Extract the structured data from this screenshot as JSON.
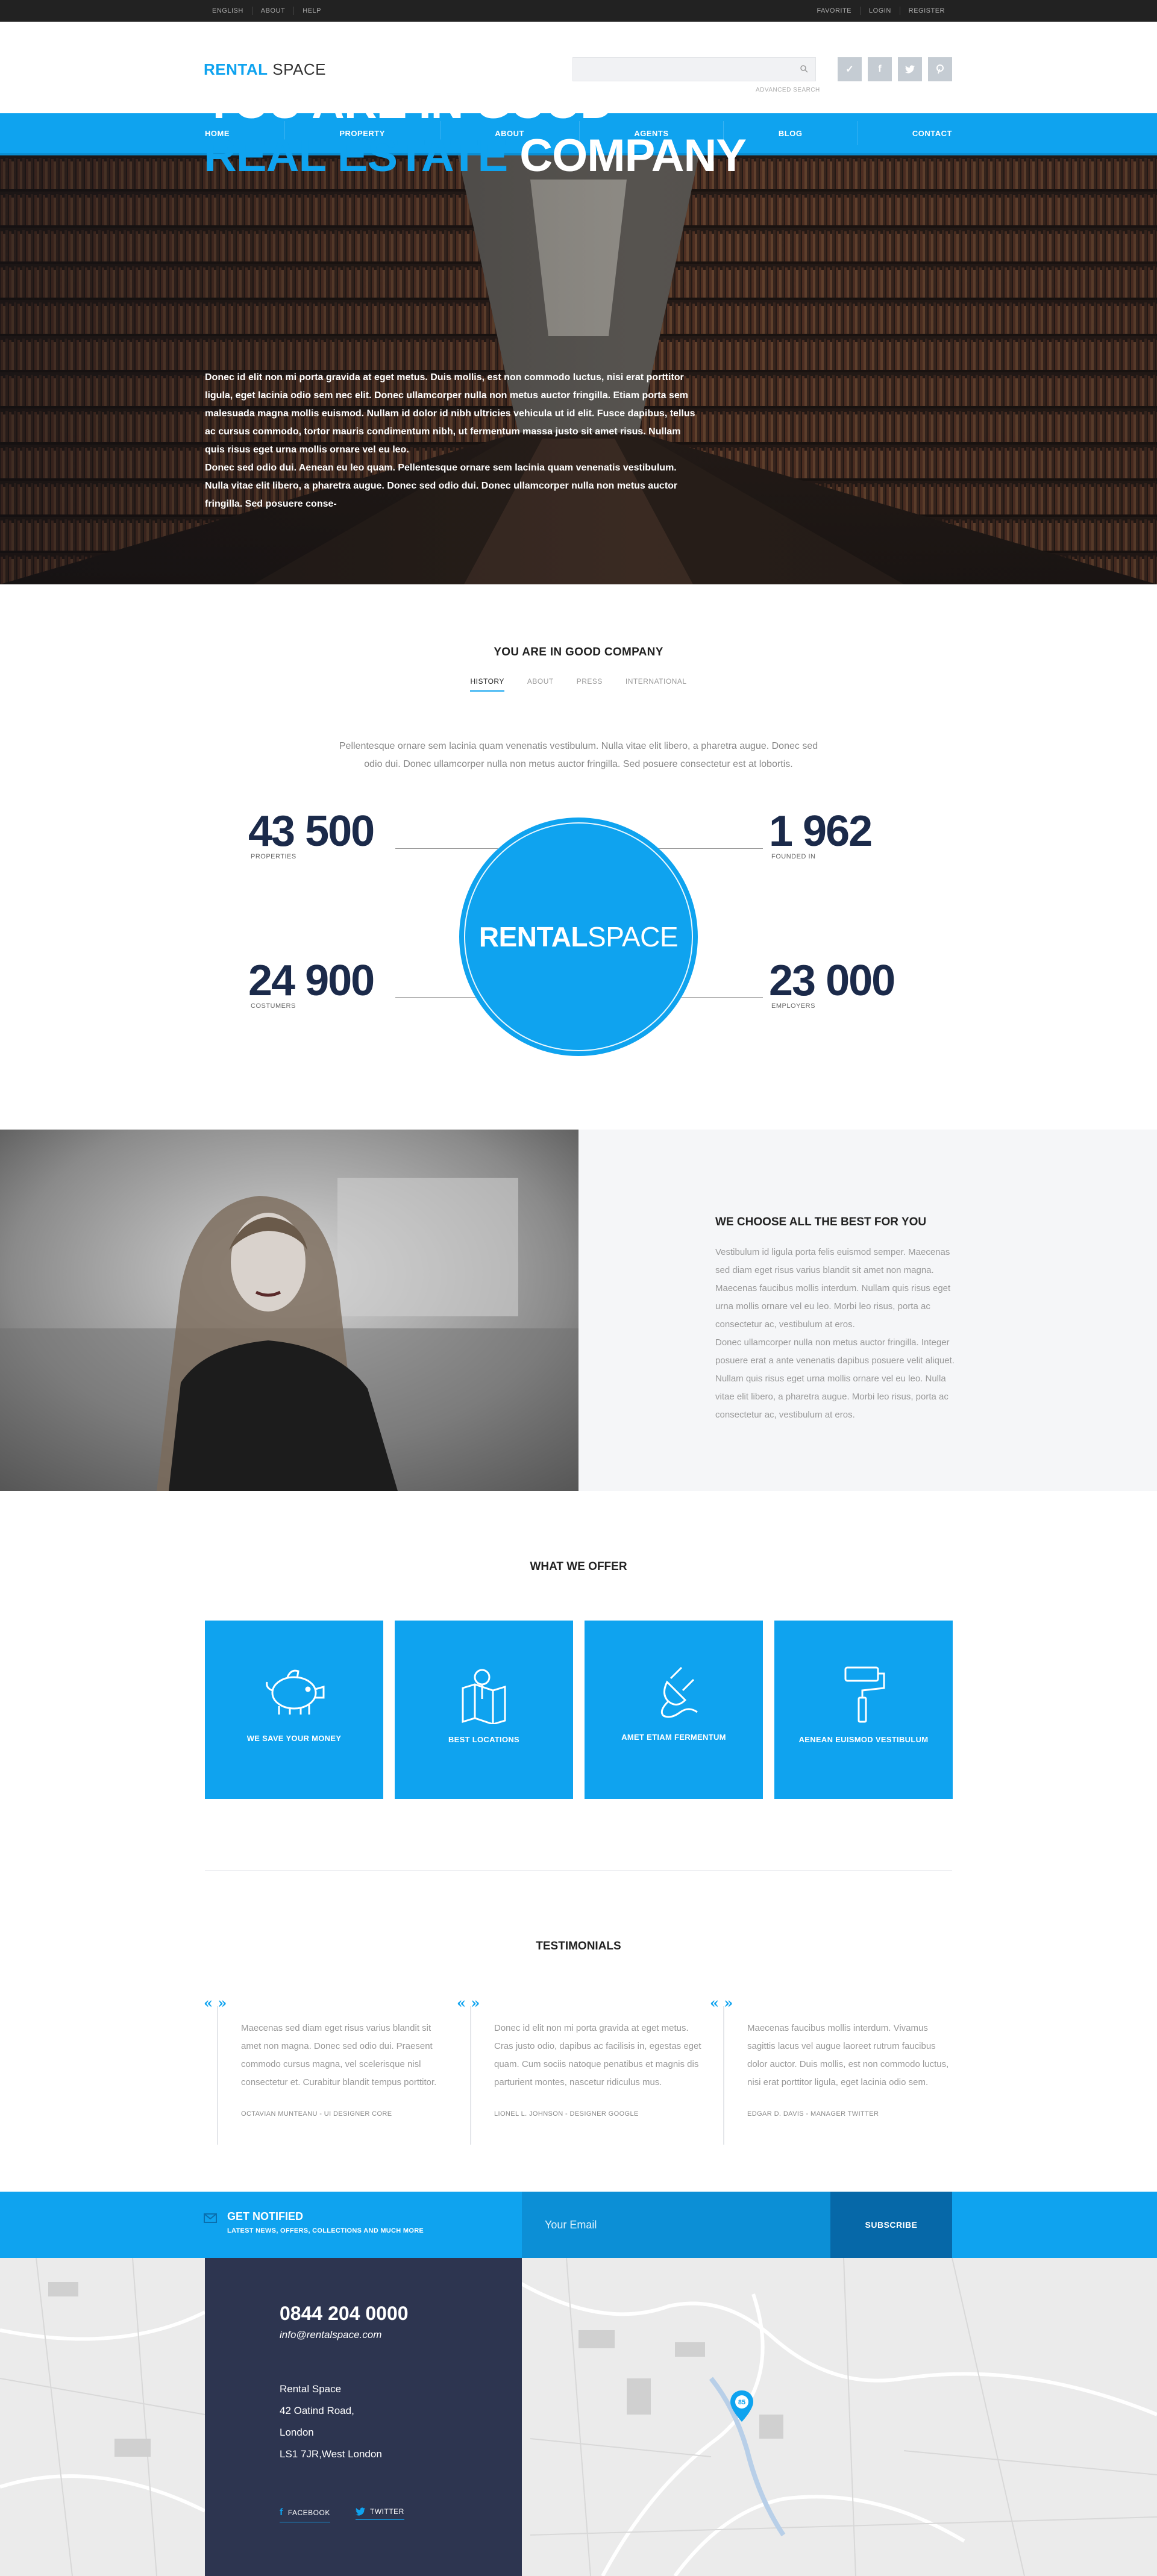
{
  "topbar": {
    "left": [
      "ENGLISH",
      "ABOUT",
      "HELP"
    ],
    "right": [
      "FAVORITE",
      "LOGIN",
      "REGISTER"
    ]
  },
  "header": {
    "logo_bold": "RENTAL",
    "logo_rest": " SPACE",
    "search_placeholder": "",
    "advanced_search": "ADVANCED SEARCH",
    "social_icons": [
      "check-icon",
      "facebook-icon",
      "twitter-icon",
      "pinterest-icon"
    ]
  },
  "nav": [
    "HOME",
    "PROPERTY",
    "ABOUT",
    "AGENTS",
    "BLOG",
    "CONTACT"
  ],
  "hero": {
    "line1": "YOU ARE IN GOOD",
    "line2_accent": "REAL ESTATE",
    "line2_rest": " COMPANY",
    "p1": "Donec id elit non mi porta gravida at eget metus. Duis mollis, est non commodo luctus, nisi erat porttitor ligula, eget lacinia odio sem nec elit. Donec ullamcorper nulla non metus auctor fringilla. Etiam porta sem malesuada magna mollis euismod. Nullam id dolor id nibh ultricies vehicula ut id elit. Fusce dapibus, tellus ac cursus commodo, tortor mauris condimentum nibh, ut fermentum massa justo sit amet risus. Nullam quis risus eget urna mollis ornare vel eu leo.",
    "p2": "Donec sed odio dui. Aenean eu leo quam. Pellentesque ornare sem lacinia quam venenatis vestibulum. Nulla vitae elit libero, a pharetra augue. Donec sed odio dui. Donec ullamcorper nulla non metus auctor fringilla. Sed posuere conse-"
  },
  "about": {
    "title": "YOU ARE IN GOOD COMPANY",
    "tabs": [
      "HISTORY",
      "ABOUT",
      "PRESS",
      "INTERNATIONAL"
    ],
    "active_tab": "HISTORY",
    "text": "Pellentesque ornare sem lacinia quam venenatis vestibulum. Nulla vitae elit libero, a pharetra augue. Donec sed odio dui. Donec ullamcorper nulla non metus auctor fringilla. Sed posuere consectetur est at lobortis.",
    "stats": [
      {
        "value": "43 500",
        "label": "PROPERTIES"
      },
      {
        "value": "1 962",
        "label": "FOUNDED IN"
      },
      {
        "value": "24 900",
        "label": "COSTUMERS"
      },
      {
        "value": "23 000",
        "label": "EMPLOYERS"
      }
    ],
    "circle_bold": "RENTAL",
    "circle_rest": "SPACE"
  },
  "feature": {
    "title": "WE CHOOSE ALL THE BEST FOR YOU",
    "p1": "Vestibulum id ligula porta felis euismod semper. Maecenas sed diam eget risus varius blandit sit amet non magna. Maecenas faucibus mollis interdum. Nullam quis risus eget urna mollis ornare vel eu leo. Morbi leo risus, porta ac consectetur ac, vestibulum at eros.",
    "p2": "Donec ullamcorper nulla non metus auctor fringilla. Integer posuere erat a ante venenatis dapibus posuere velit aliquet. Nullam quis risus eget urna mollis ornare vel eu leo. Nulla vitae elit libero, a pharetra augue. Morbi leo risus, porta ac consectetur ac, vestibulum at eros."
  },
  "offer": {
    "title": "WHAT WE OFFER",
    "cards": [
      {
        "label": "WE SAVE YOUR MONEY",
        "icon": "piggy-bank-icon"
      },
      {
        "label": "BEST LOCATIONS",
        "icon": "map-pin-icon"
      },
      {
        "label": "AMET ETIAM FERMENTUM",
        "icon": "plug-icon"
      },
      {
        "label": "AENEAN EUISMOD VESTIBULUM",
        "icon": "paint-roller-icon"
      }
    ]
  },
  "testimonials": {
    "title": "TESTIMONIALS",
    "quote_mark": "« »",
    "items": [
      {
        "text": "Maecenas sed diam eget risus varius blandit sit amet non magna. Donec sed odio dui. Praesent commodo cursus magna, vel scelerisque nisl consectetur et. Curabitur blandit tempus porttitor.",
        "author": "OCTAVIAN MUNTEANU - UI DESIGNER CORE"
      },
      {
        "text": "Donec id elit non mi porta gravida at eget metus. Cras justo odio, dapibus ac facilisis in, egestas eget quam. Cum sociis natoque penatibus et magnis dis parturient montes, nascetur ridiculus mus.",
        "author": "LIONEL L. JOHNSON - DESIGNER GOOGLE"
      },
      {
        "text": "Maecenas faucibus mollis interdum. Vivamus sagittis lacus vel augue laoreet rutrum faucibus dolor auctor. Duis mollis, est non commodo luctus, nisi erat porttitor ligula, eget lacinia odio sem.",
        "author": "EDGAR D. DAVIS - MANAGER TWITTER"
      }
    ]
  },
  "notify": {
    "title": "GET NOTIFIED",
    "subtitle": "LATEST NEWS, OFFERS, COLLECTIONS AND MUCH MORE",
    "email_placeholder": "Your Email",
    "button": "SUBSCRIBE"
  },
  "footer": {
    "phone": "0844 204 0000",
    "email": "info@rentalspace.com",
    "address": [
      "Rental Space",
      "42 Oatind Road,",
      "London",
      "LS1 7JR,West London"
    ],
    "facebook": "FACEBOOK",
    "twitter": "TWITTER",
    "map_marker": "85"
  },
  "colors": {
    "accent": "#0fa3ef",
    "dark": "#2d3550",
    "navy": "#1b2a4a"
  }
}
